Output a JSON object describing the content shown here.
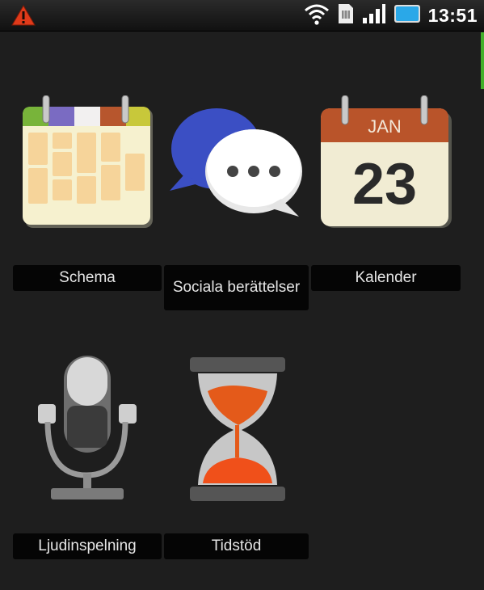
{
  "status_bar": {
    "time": "13:51",
    "icons": [
      "warning-icon",
      "wifi-icon",
      "sim-icon",
      "signal-icon",
      "battery-icon"
    ],
    "battery_color": "#2aa8e8",
    "warning_color": "#e03a1a"
  },
  "apps": [
    {
      "id": "schema",
      "label": "Schema",
      "icon": "schedule-calendar-icon"
    },
    {
      "id": "sociala",
      "label": "Sociala berättelser",
      "icon": "speech-bubbles-icon"
    },
    {
      "id": "kalender",
      "label": "Kalender",
      "icon": "calendar-icon",
      "calendar_month": "JAN",
      "calendar_day": "23"
    },
    {
      "id": "ljud",
      "label": "Ljudinspelning",
      "icon": "microphone-icon"
    },
    {
      "id": "tid",
      "label": "Tidstöd",
      "icon": "hourglass-icon"
    }
  ],
  "accent_color": "#43b02a"
}
